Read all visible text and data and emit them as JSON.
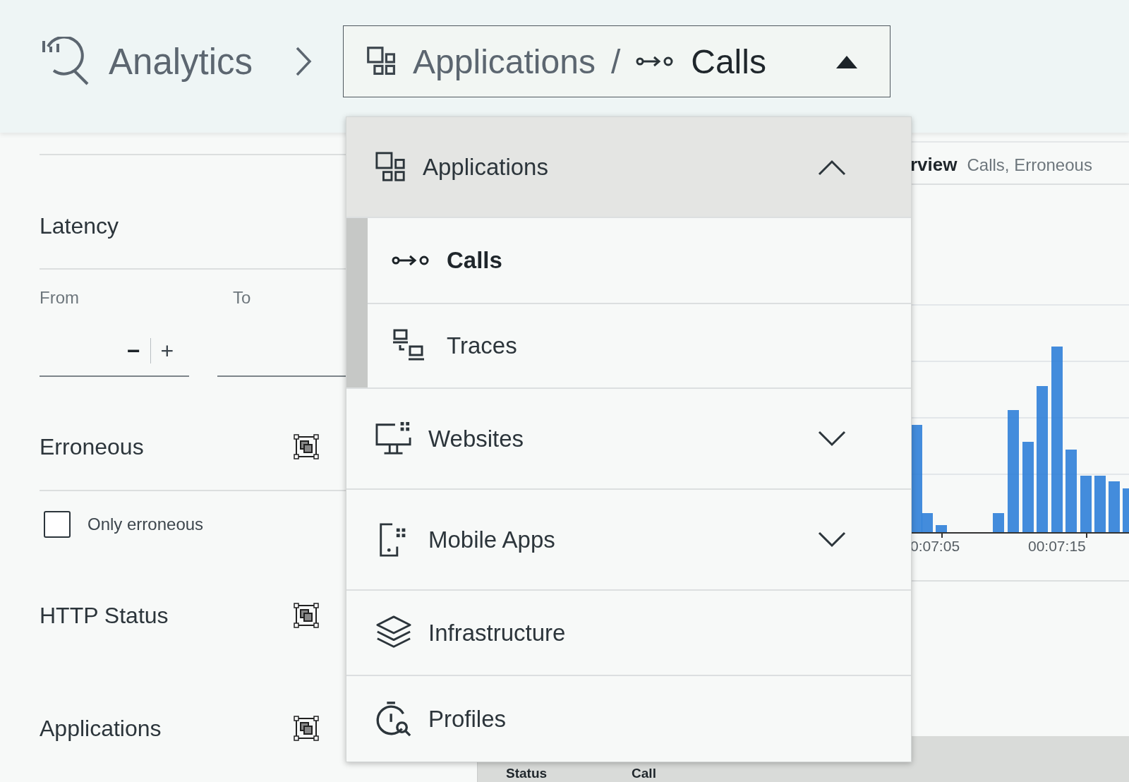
{
  "breadcrumb": {
    "root": "Analytics",
    "parent": "Applications",
    "separator": "/",
    "current": "Calls",
    "expanded": true
  },
  "filters": [
    {
      "title": "Latency",
      "kind": "range",
      "from_label": "From",
      "to_label": "To",
      "minus": "−",
      "plus": "+"
    },
    {
      "title": "Erroneous",
      "kind": "checkbox",
      "option": "Only erroneous",
      "checked": false
    },
    {
      "title": "HTTP Status",
      "kind": "plain"
    },
    {
      "title": "Applications",
      "kind": "plain"
    }
  ],
  "chart": {
    "title": "rview",
    "subtitle": "Calls, Erroneous",
    "tick_labels": [
      "0:07:05",
      "00:07:15"
    ]
  },
  "table": {
    "columns": [
      "Status",
      "Call"
    ]
  },
  "menu": [
    {
      "label": "Applications",
      "kind": "group",
      "expanded": true,
      "children": [
        {
          "label": "Calls",
          "selected": true
        },
        {
          "label": "Traces",
          "selected": false
        }
      ]
    },
    {
      "label": "Websites",
      "kind": "group",
      "expanded": false
    },
    {
      "label": "Mobile Apps",
      "kind": "group",
      "expanded": false
    },
    {
      "label": "Infrastructure",
      "kind": "link"
    },
    {
      "label": "Profiles",
      "kind": "link"
    }
  ]
}
